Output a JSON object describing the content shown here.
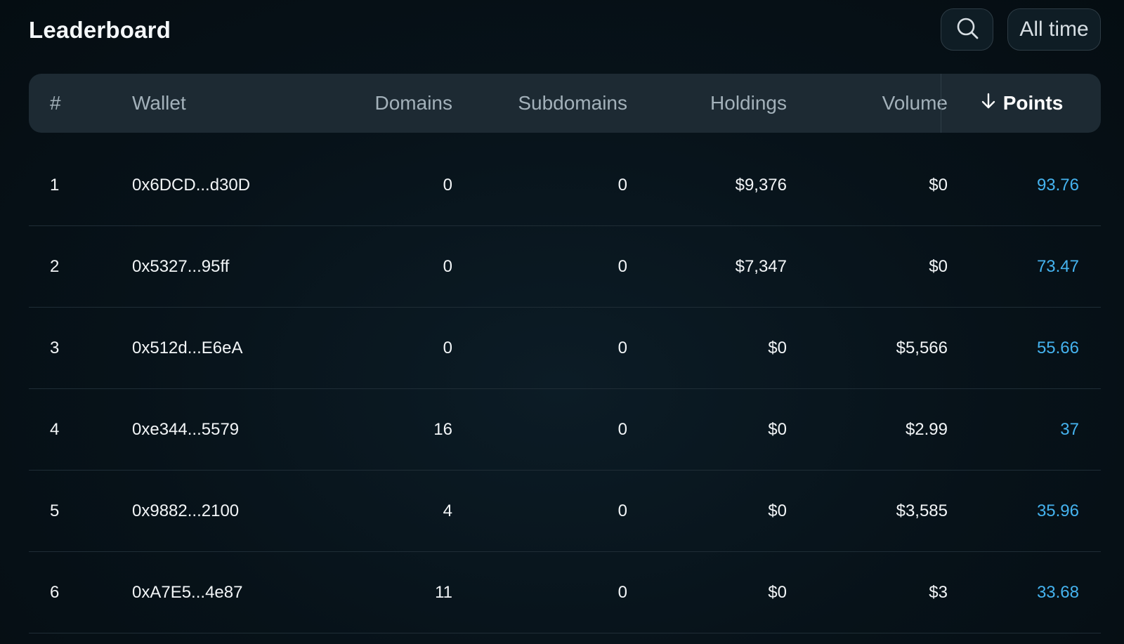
{
  "header": {
    "title": "Leaderboard",
    "search_icon": "search-icon",
    "range_label": "All time"
  },
  "table": {
    "columns": {
      "rank": "#",
      "wallet": "Wallet",
      "domains": "Domains",
      "subdomains": "Subdomains",
      "holdings": "Holdings",
      "volume": "Volume",
      "points": "Points"
    },
    "sort_icon": "arrow-down-icon",
    "rows": [
      {
        "rank": "1",
        "wallet": "0x6DCD...d30D",
        "domains": "0",
        "subdomains": "0",
        "holdings": "$9,376",
        "volume": "$0",
        "points": "93.76"
      },
      {
        "rank": "2",
        "wallet": "0x5327...95ff",
        "domains": "0",
        "subdomains": "0",
        "holdings": "$7,347",
        "volume": "$0",
        "points": "73.47"
      },
      {
        "rank": "3",
        "wallet": "0x512d...E6eA",
        "domains": "0",
        "subdomains": "0",
        "holdings": "$0",
        "volume": "$5,566",
        "points": "55.66"
      },
      {
        "rank": "4",
        "wallet": "0xe344...5579",
        "domains": "16",
        "subdomains": "0",
        "holdings": "$0",
        "volume": "$2.99",
        "points": "37"
      },
      {
        "rank": "5",
        "wallet": "0x9882...2100",
        "domains": "4",
        "subdomains": "0",
        "holdings": "$0",
        "volume": "$3,585",
        "points": "35.96"
      },
      {
        "rank": "6",
        "wallet": "0xA7E5...4e87",
        "domains": "11",
        "subdomains": "0",
        "holdings": "$0",
        "volume": "$3",
        "points": "33.68"
      }
    ]
  },
  "colors": {
    "background": "#071219",
    "header_row": "#1d2a33",
    "points_accent": "#45b3ef",
    "text": "#f2f5f7",
    "muted_text": "#a3b1ba"
  }
}
